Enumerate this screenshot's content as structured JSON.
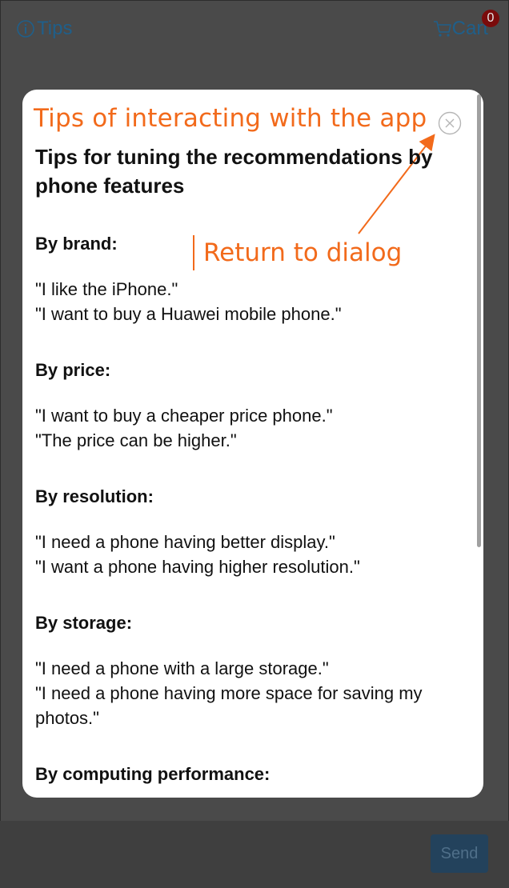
{
  "topbar": {
    "tips_label": "Tips",
    "cart_label": "Cart",
    "cart_count": "0"
  },
  "bottom": {
    "send_label": "Send"
  },
  "modal": {
    "annotation_title": "Tips of interacting with the app",
    "annotation_close": "Return to dialog",
    "title": "Tips for tuning the recommendations by phone features",
    "sections": [
      {
        "heading": "By brand:",
        "examples": [
          "\"I like the iPhone.\"",
          "\"I want to buy a Huawei mobile phone.\""
        ]
      },
      {
        "heading": "By price:",
        "examples": [
          "\"I want to buy a cheaper price phone.\"",
          "\"The price can be higher.\""
        ]
      },
      {
        "heading": "By resolution:",
        "examples": [
          "\"I need a phone having better display.\"",
          "\"I want a phone having higher resolution.\""
        ]
      },
      {
        "heading": "By storage:",
        "examples": [
          "\"I need a phone with a large storage.\"",
          "\"I need a phone having more space for saving my photos.\""
        ]
      },
      {
        "heading": "By computing performance:",
        "examples": []
      }
    ]
  },
  "colors": {
    "annotation": "#f26a1b",
    "link": "#1f5f8a",
    "badge": "#7a0b0b",
    "overlay": "#4a4a4a"
  },
  "icons": {
    "tips": "info-circle-icon",
    "cart": "cart-icon",
    "close": "close-circle-icon"
  }
}
